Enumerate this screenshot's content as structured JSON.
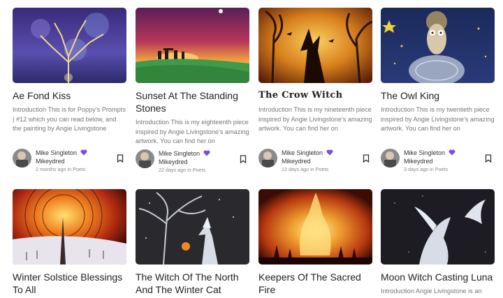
{
  "cards": [
    {
      "title": "Ae Fond Kiss",
      "excerpt": "Introduction This is for Poppy's Prompts | #12 which you can read below, and the painting by Angie Livingstone (The...",
      "author": "Mike Singleton",
      "handle": "Mikeydred",
      "ago": "2 months ago in Poets",
      "icon": "bookmark-icon"
    },
    {
      "title": "Sunset At The Standing Stones",
      "excerpt": "Introduction This is my eighteenth piece inspired by Angie Livingstone's amazing artwork. You can find her on Facebook...",
      "author": "Mike Singleton",
      "handle": "Mikeydred",
      "ago": "22 days ago in Poets",
      "icon": "bookmark-icon"
    },
    {
      "title": "The Crow Witch",
      "excerpt": "Introduction This is my nineteenth piece inspired by Angie Livingstone's amazing artwork. You can find her on Facebook...",
      "author": "Mike Singleton",
      "handle": "Mikeydred",
      "ago": "12 days ago in Poets",
      "icon": "bookmark-icon"
    },
    {
      "title": "The Owl King",
      "excerpt": "Introduction This is my twentieth piece inspired by Angie Livingstone's amazing artwork. You can find her on Facebook...",
      "author": "Mike Singleton",
      "handle": "Mikeydred",
      "ago": "3 days ago in Poets",
      "icon": "bookmark-icon"
    },
    {
      "title": "Winter Solstice Blessings To All"
    },
    {
      "title": "The Witch Of The North And The Winter Cat"
    },
    {
      "title": "Keepers Of The Sacred Fire"
    },
    {
      "title": "Moon Witch Casting Luna",
      "excerpt": "Introduction Angie Livingstone is an"
    }
  ],
  "colors": {
    "verified_heart": "#7b4fd6",
    "muted_text": "#777777"
  }
}
